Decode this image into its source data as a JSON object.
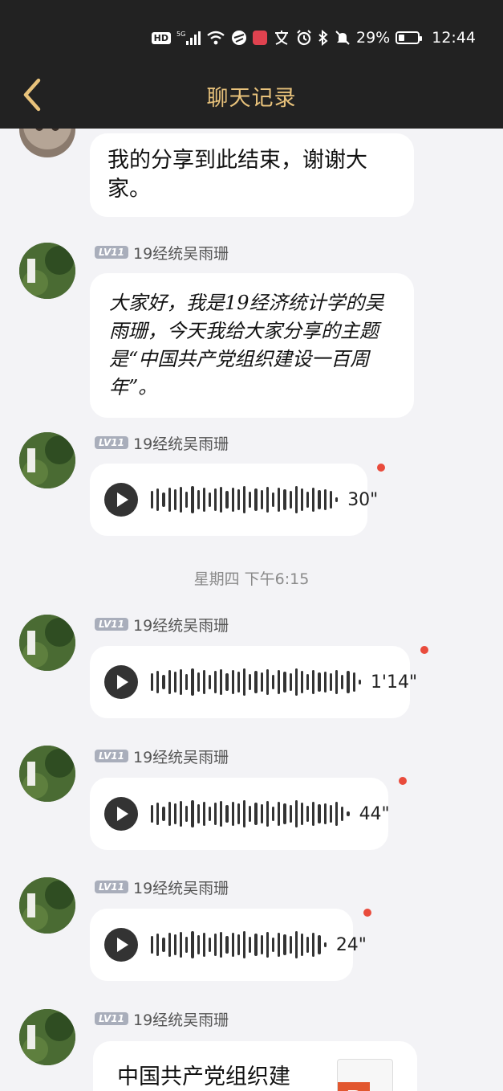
{
  "status_bar": {
    "hd": "HD",
    "signal": "5G",
    "battery": "29%",
    "time": "12:44"
  },
  "header": {
    "title": "聊天记录"
  },
  "messages": [
    {
      "type": "text",
      "text": "我的分享到此结束，谢谢大家。"
    },
    {
      "type": "text",
      "user": "19经统吴雨珊",
      "level": "LV11",
      "text": "大家好，我是19经济统计学的吴雨珊，今天我给大家分享的主题是“中国共产党组织建设一百周年”。"
    },
    {
      "type": "voice",
      "user": "19经统吴雨珊",
      "level": "LV11",
      "duration": "30\"",
      "unread": true
    },
    {
      "type": "time",
      "text": "星期四 下午6:15"
    },
    {
      "type": "voice",
      "user": "19经统吴雨珊",
      "level": "LV11",
      "duration": "1'14\"",
      "unread": true
    },
    {
      "type": "voice",
      "user": "19经统吴雨珊",
      "level": "LV11",
      "duration": "44\"",
      "unread": true
    },
    {
      "type": "voice",
      "user": "19经统吴雨珊",
      "level": "LV11",
      "duration": "24\"",
      "unread": true
    },
    {
      "type": "file",
      "user": "19经统吴雨珊",
      "level": "LV11",
      "file_title": "中国共产党组织建",
      "file_icon": "ppt-icon"
    }
  ],
  "colors": {
    "header_bg": "#222222",
    "title": "#e8c27b",
    "chat_bg": "#f3f3f6",
    "unread_dot": "#e94b3c"
  }
}
